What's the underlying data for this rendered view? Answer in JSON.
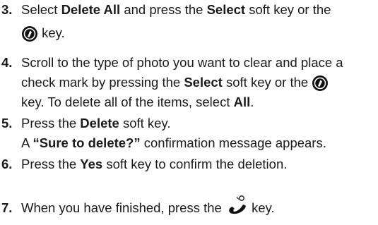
{
  "steps": [
    {
      "number": "3.",
      "line1": {
        "t1": "Select ",
        "b1": "Delete All",
        "t2": " and press the ",
        "b2": "Select",
        "t3": " soft key or the"
      },
      "line2": {
        "t1": " key."
      },
      "icon": "ok-key-icon"
    },
    {
      "number": "4.",
      "line1": {
        "t1": "Scroll to the type of photo you want to clear and place a"
      },
      "line2": {
        "t1": "check mark by pressing the ",
        "b1": "Select",
        "t2": " soft key or the "
      },
      "line3": {
        "t1": "key. To delete all of the items, select ",
        "b1": "All",
        "t2": "."
      },
      "icon": "ok-key-icon"
    },
    {
      "number": "5.",
      "line1": {
        "t1": "Press the ",
        "b1": "Delete",
        "t2": " soft key."
      },
      "line2": {
        "t1": "A ",
        "b1": "“Sure to delete?”",
        "t2": " confirmation message appears."
      }
    },
    {
      "number": "6.",
      "line1": {
        "t1": "Press the ",
        "b1": "Yes",
        "t2": " soft key to confirm the deletion."
      }
    },
    {
      "number": "7.",
      "line1": {
        "t1": "When you have finished, press the ",
        "t2": " key."
      },
      "icon": "end-call-key-icon"
    }
  ]
}
